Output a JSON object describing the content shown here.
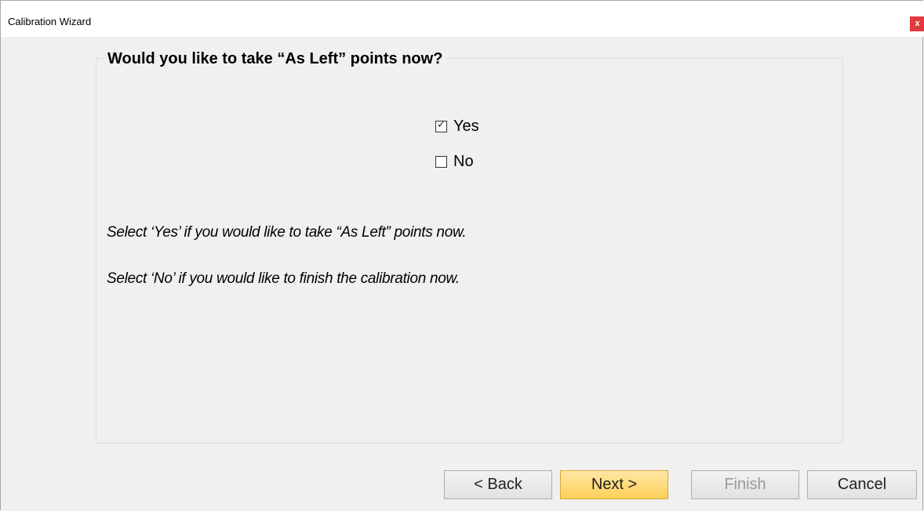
{
  "window": {
    "title": "Calibration Wizard",
    "close_label": "x"
  },
  "group": {
    "legend": "Would you like to take “As Left” points now?"
  },
  "options": [
    {
      "label": "Yes",
      "checked": true,
      "check_glyph": "✓"
    },
    {
      "label": "No",
      "checked": false,
      "check_glyph": ""
    }
  ],
  "help": {
    "line1": "Select ‘Yes’ if you would like to take “As Left” points now.",
    "line2": "Select ‘No’ if you would like to finish the calibration now."
  },
  "buttons": {
    "back": "< Back",
    "next": "Next >",
    "finish": "Finish",
    "cancel": "Cancel"
  },
  "colors": {
    "close_button": "#e0393e",
    "next_button": "#ffcf58"
  }
}
